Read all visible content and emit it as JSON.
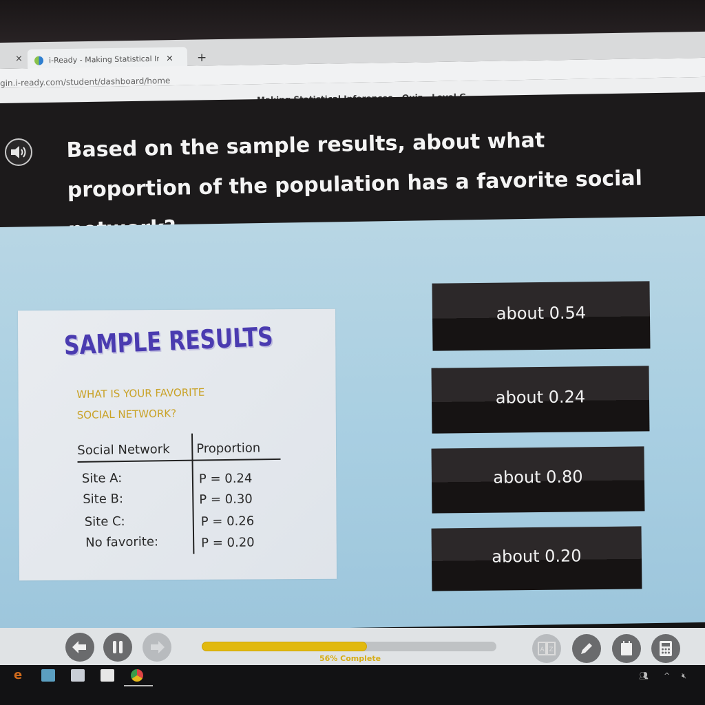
{
  "browser": {
    "prev_tab_close": "×",
    "active_tab": {
      "favicon": "iready-favicon-icon",
      "title": "i-Ready - Making Statistical Infe",
      "close": "×"
    },
    "new_tab": "+",
    "address": "gin.i-ready.com/student/dashboard/home"
  },
  "lesson": {
    "title": "Making Statistical Inferences - Quiz - Level G"
  },
  "question": {
    "audio_icon": "speaker-icon",
    "text": "Based on the sample results, about what proportion of the population has a favorite social network?"
  },
  "card": {
    "title": "SAMPLE RESULTS",
    "subtitle_line1": "WHAT IS YOUR FAVORITE",
    "subtitle_line2": "SOCIAL NETWORK?",
    "table": {
      "headers": [
        "Social Network",
        "Proportion"
      ],
      "rows": [
        {
          "network": "Site A:",
          "proportion": "P = 0.24"
        },
        {
          "network": "Site B:",
          "proportion": "P = 0.30"
        },
        {
          "network": "Site C:",
          "proportion": "P = 0.26"
        },
        {
          "network": "No favorite:",
          "proportion": "P = 0.20"
        }
      ]
    }
  },
  "answers": [
    {
      "label": "about 0.54"
    },
    {
      "label": "about 0.24"
    },
    {
      "label": "about 0.80"
    },
    {
      "label": "about 0.20"
    }
  ],
  "footer": {
    "back_icon": "arrow-left-icon",
    "pause_icon": "pause-icon",
    "next_icon": "arrow-right-icon",
    "progress_percent": 56,
    "progress_label": "56% Complete",
    "glossary_icon": "glossary-az-icon",
    "pencil_icon": "pencil-icon",
    "notes_icon": "notepad-icon",
    "calculator_icon": "calculator-icon"
  },
  "taskbar": {
    "apps": [
      "edge-icon",
      "file-explorer-icon",
      "store-icon",
      "mail-icon",
      "chrome-icon"
    ],
    "tray": [
      "people-icon",
      "chevron-up-icon",
      "volume-muted-icon"
    ]
  },
  "colors": {
    "header_bg": "#1c1a1b",
    "content_bg": "#a9cfe2",
    "answer_bg": "#2c2829",
    "title_purple": "#4a3bb0",
    "subtitle_gold": "#c9a227",
    "progress_yellow": "#e1b90e"
  }
}
